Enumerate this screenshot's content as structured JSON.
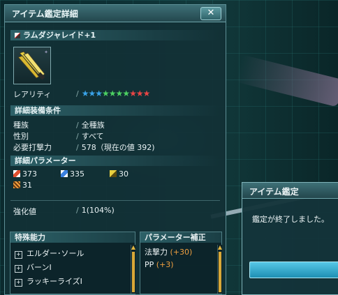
{
  "window": {
    "title": "アイテム鑑定詳細",
    "close_label": "✕"
  },
  "item": {
    "name": "ラムダジャレイド+1",
    "rarity_label": "レアリティ",
    "rarity_stars": 10,
    "star_colors": [
      "#3aa3e8",
      "#3aa3e8",
      "#3aa3e8",
      "#4cd162",
      "#4cd162",
      "#4cd162",
      "#4cd162",
      "#e84545",
      "#e84545",
      "#e84545"
    ]
  },
  "requirements": {
    "header": "詳細装備条件",
    "rows": [
      {
        "label": "種族",
        "value": "全種族"
      },
      {
        "label": "性別",
        "value": "すべて"
      },
      {
        "label": "必要打撃力",
        "value": "578（現在の値 392)"
      }
    ]
  },
  "parameters": {
    "header": "詳細パラメーター",
    "values": [
      {
        "icon": "melee-attack-icon",
        "value": "373"
      },
      {
        "icon": "ranged-attack-icon",
        "value": "335"
      },
      {
        "icon": "tech-attack-icon",
        "value": "30"
      },
      {
        "icon": "dexterity-icon",
        "value": "31"
      }
    ]
  },
  "grind": {
    "label": "強化値",
    "value": "1(104%)"
  },
  "abilities": {
    "header": "特殊能力",
    "items": [
      "エルダー･ソール",
      "バーンI",
      "ラッキーライズI"
    ]
  },
  "param_bonus": {
    "header": "パラメーター補正",
    "items": [
      {
        "label": "法撃力",
        "value": "(+30)"
      },
      {
        "label": "PP",
        "value": "(+3)"
      }
    ]
  },
  "dialog": {
    "title": "アイテム鑑定",
    "message": "鑑定が終了しました。"
  },
  "colors": {
    "accent_orange": "#f0a040",
    "highlight_cyan": "#56c7e6"
  }
}
